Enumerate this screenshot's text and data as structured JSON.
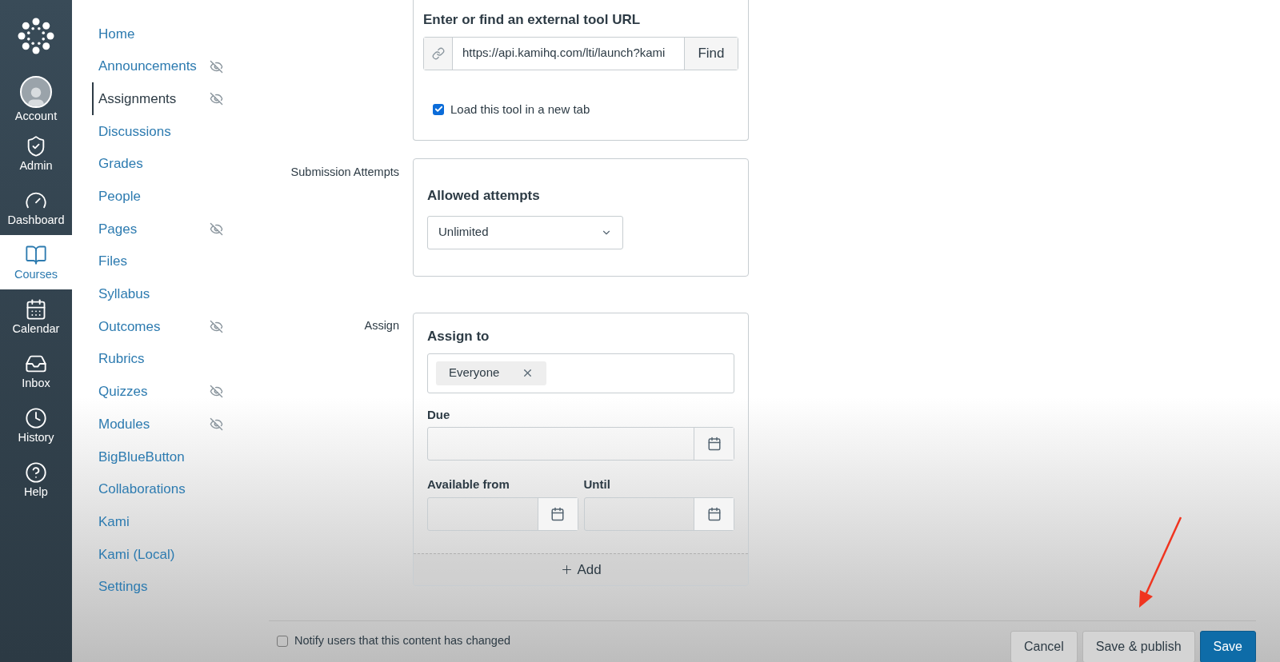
{
  "rail": {
    "items": [
      {
        "label": "Account",
        "selected": false
      },
      {
        "label": "Admin",
        "selected": false
      },
      {
        "label": "Dashboard",
        "selected": false
      },
      {
        "label": "Courses",
        "selected": true
      },
      {
        "label": "Calendar",
        "selected": false
      },
      {
        "label": "Inbox",
        "selected": false
      },
      {
        "label": "History",
        "selected": false
      },
      {
        "label": "Help",
        "selected": false
      }
    ]
  },
  "course_nav": {
    "items": [
      {
        "label": "Home",
        "selected": false,
        "hidden": false
      },
      {
        "label": "Announcements",
        "selected": false,
        "hidden": true
      },
      {
        "label": "Assignments",
        "selected": true,
        "hidden": true
      },
      {
        "label": "Discussions",
        "selected": false,
        "hidden": false
      },
      {
        "label": "Grades",
        "selected": false,
        "hidden": false
      },
      {
        "label": "People",
        "selected": false,
        "hidden": false
      },
      {
        "label": "Pages",
        "selected": false,
        "hidden": true
      },
      {
        "label": "Files",
        "selected": false,
        "hidden": false
      },
      {
        "label": "Syllabus",
        "selected": false,
        "hidden": false
      },
      {
        "label": "Outcomes",
        "selected": false,
        "hidden": true
      },
      {
        "label": "Rubrics",
        "selected": false,
        "hidden": false
      },
      {
        "label": "Quizzes",
        "selected": false,
        "hidden": true
      },
      {
        "label": "Modules",
        "selected": false,
        "hidden": true
      },
      {
        "label": "BigBlueButton",
        "selected": false,
        "hidden": false
      },
      {
        "label": "Collaborations",
        "selected": false,
        "hidden": false
      },
      {
        "label": "Kami",
        "selected": false,
        "hidden": false
      },
      {
        "label": "Kami (Local)",
        "selected": false,
        "hidden": false
      },
      {
        "label": "Settings",
        "selected": false,
        "hidden": false
      }
    ]
  },
  "external_tool": {
    "heading": "Enter or find an external tool URL",
    "url": "https://api.kamihq.com/lti/launch?kami",
    "find_button": "Find",
    "new_tab": {
      "label": "Load this tool in a new tab",
      "checked": true
    }
  },
  "submission_attempts": {
    "label": "Submission Attempts",
    "heading": "Allowed attempts",
    "value": "Unlimited"
  },
  "assign": {
    "label": "Assign",
    "heading": "Assign to",
    "assignees": [
      {
        "label": "Everyone"
      }
    ],
    "due": {
      "label": "Due"
    },
    "available_from": {
      "label": "Available from"
    },
    "until": {
      "label": "Until"
    },
    "add_button": "Add"
  },
  "footer": {
    "notify": {
      "label": "Notify users that this content has changed",
      "checked": false
    },
    "buttons": [
      {
        "label": "Cancel",
        "kind": "default"
      },
      {
        "label": "Save & publish",
        "kind": "default"
      },
      {
        "label": "Save",
        "kind": "primary"
      }
    ]
  }
}
